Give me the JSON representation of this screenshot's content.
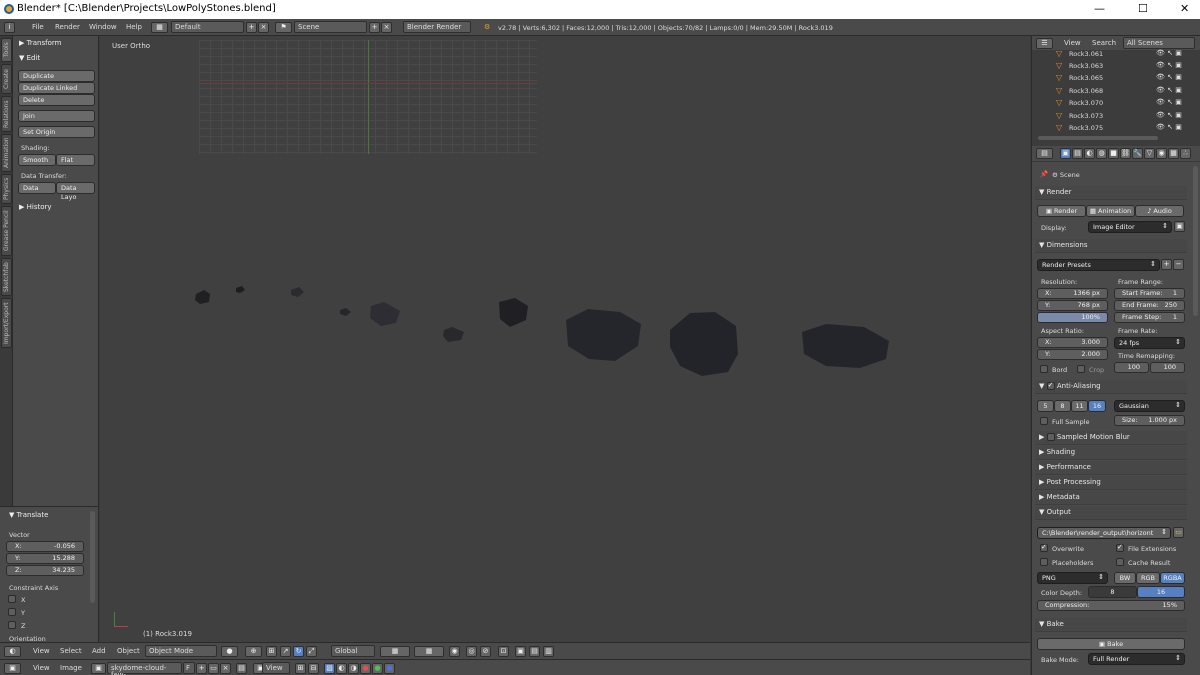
{
  "window": {
    "title": "Blender* [C:\\Blender\\Projects\\LowPolyStones.blend]",
    "minimize": "—",
    "maximize": "☐",
    "close": "✕"
  },
  "info": {
    "menus": [
      "File",
      "Render",
      "Window",
      "Help"
    ],
    "layout": "Default",
    "scene": "Scene",
    "engine": "Blender Render",
    "stats": "v2.78 | Verts:6,302 | Faces:12,000 | Tris:12,000 | Objects:70/82 | Lamps:0/0 | Mem:29.50M | Rock3.019"
  },
  "tabs": [
    "Tools",
    "Create",
    "Relations",
    "Animation",
    "Physics",
    "Grease Pencil",
    "Sketchfab",
    "Import/Export"
  ],
  "tools": {
    "transform": "Transform",
    "edit": "Edit",
    "duplicate": "Duplicate",
    "duplicate_linked": "Duplicate Linked",
    "delete": "Delete",
    "join": "Join",
    "set_origin": "Set Origin",
    "shading": "Shading:",
    "smooth": "Smooth",
    "flat": "Flat",
    "data_transfer": "Data Transfer:",
    "data": "Data",
    "data_layo": "Data Layo",
    "history": "History"
  },
  "translate": {
    "title": "Translate",
    "vector": "Vector",
    "x_key": "X:",
    "x": "-0.056",
    "y_key": "Y:",
    "y": "15.288",
    "z_key": "Z:",
    "z": "34.235",
    "constraint": "Constraint Axis",
    "ax": "X",
    "ay": "Y",
    "az": "Z",
    "orientation": "Orientation"
  },
  "viewport": {
    "view_label": "User Ortho",
    "object_label": "(1) Rock3.019"
  },
  "header3d": {
    "view": "View",
    "select": "Select",
    "add": "Add",
    "object": "Object",
    "mode": "Object Mode",
    "orientation": "Global"
  },
  "imgheader": {
    "view": "View",
    "image": "Image",
    "image_name": "skydome-cloud-few-...",
    "f": "F",
    "view2": "View"
  },
  "outliner": {
    "view": "View",
    "search": "Search",
    "scenes": "All Scenes",
    "rows": [
      "Rock3.061",
      "Rock3.063",
      "Rock3.065",
      "Rock3.068",
      "Rock3.070",
      "Rock3.073",
      "Rock3.075"
    ]
  },
  "props": {
    "scene": "Scene",
    "render": "Render",
    "render_btn": "Render",
    "animation_btn": "Animation",
    "audio_btn": "Audio",
    "display_label": "Display:",
    "display": "Image Editor",
    "dimensions": "Dimensions",
    "presets": "Render Presets",
    "resolution": "Resolution:",
    "res_x_k": "X:",
    "res_x": "1366 px",
    "res_y_k": "Y:",
    "res_y": "768 px",
    "res_pct": "100%",
    "frame_range": "Frame Range:",
    "start_k": "Start Frame:",
    "start": "1",
    "end_k": "End Frame:",
    "end": "250",
    "step_k": "Frame Step:",
    "step": "1",
    "aspect": "Aspect Ratio:",
    "asp_x_k": "X:",
    "asp_x": "3.000",
    "asp_y_k": "Y:",
    "asp_y": "2.000",
    "frame_rate": "Frame Rate:",
    "fps": "24 fps",
    "time_remap": "Time Remapping:",
    "tr_old": "100",
    "tr_new": "100",
    "bord": "Bord",
    "crop": "Crop",
    "aa": "Anti-Aliasing",
    "aa_samples": [
      "5",
      "8",
      "11",
      "16"
    ],
    "filter": "Gaussian",
    "full_sample": "Full Sample",
    "size_k": "Size:",
    "size": "1.000 px",
    "motion_blur": "Sampled Motion Blur",
    "shading": "Shading",
    "performance": "Performance",
    "post": "Post Processing",
    "metadata": "Metadata",
    "output": "Output",
    "path": "C:\\Blender\\render_output\\horizont",
    "overwrite": "Overwrite",
    "file_ext": "File Extensions",
    "placeholders": "Placeholders",
    "cache": "Cache Result",
    "format": "PNG",
    "bw": "BW",
    "rgb": "RGB",
    "rgba": "RGBA",
    "color_depth": "Color Depth:",
    "d8": "8",
    "d16": "16",
    "compression": "Compression:",
    "comp_val": "15%",
    "bake": "Bake",
    "bake_btn": "Bake",
    "bake_mode_k": "Bake Mode:",
    "bake_mode": "Full Render"
  }
}
